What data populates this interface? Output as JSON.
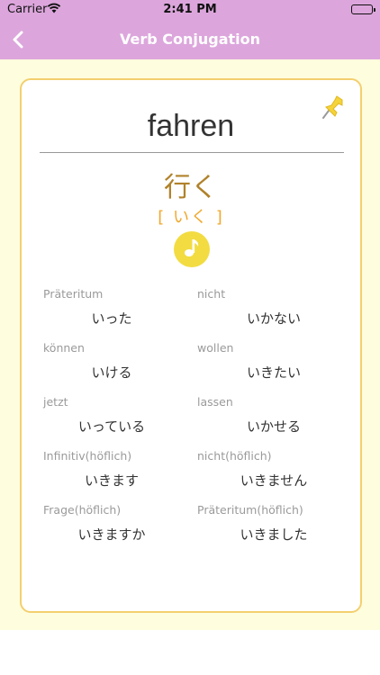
{
  "status": {
    "carrier": "Carrier",
    "time": "2:41 PM"
  },
  "nav": {
    "title": "Verb Conjugation"
  },
  "card": {
    "german": "fahren",
    "kanji": "行く",
    "kana": "[ いく ]",
    "forms": [
      {
        "left_label": "Präteritum",
        "left_value": "いった",
        "right_label": "nicht",
        "right_value": "いかない"
      },
      {
        "left_label": "können",
        "left_value": "いける",
        "right_label": "wollen",
        "right_value": "いきたい"
      },
      {
        "left_label": "jetzt",
        "left_value": "いっている",
        "right_label": "lassen",
        "right_value": "いかせる"
      },
      {
        "left_label": "Infinitiv(höflich)",
        "left_value": "いきます",
        "right_label": "nicht(höflich)",
        "right_value": "いきません"
      },
      {
        "left_label": "Frage(höflich)",
        "left_value": "いきますか",
        "right_label": "Präteritum(höflich)",
        "right_value": "いきました"
      }
    ]
  },
  "icons": {
    "back": "chevron-left-icon",
    "pin": "pushpin-icon",
    "audio": "music-note-icon"
  },
  "colors": {
    "nav_bg": "#dca6dc",
    "content_bg": "#fefdde",
    "card_border": "#f3cf6e",
    "kanji": "#b0822a",
    "kana": "#f0a82c",
    "audio_button": "#f2dc42"
  }
}
